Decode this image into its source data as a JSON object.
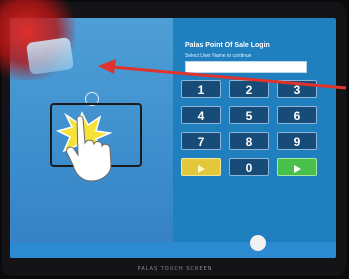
{
  "app": {
    "title": "Palas Point Of Sale Login",
    "subtitle": "Select User Name to continue",
    "username_value": ""
  },
  "keypad": {
    "keys": [
      "1",
      "2",
      "3",
      "4",
      "5",
      "6",
      "7",
      "8",
      "9"
    ],
    "zero": "0"
  },
  "bezel": {
    "brand": "PALAS  TOUCH  SCREEN"
  },
  "colors": {
    "left_pane": "#4f9ed6",
    "right_pane": "#1f7fbf",
    "key": "#184c78",
    "back_key": "#e2c83a",
    "enter_key": "#49c04b",
    "annotation_arrow": "#e0332e"
  },
  "icons": {
    "back": "arrow-left-icon",
    "enter": "arrow-right-icon",
    "touch": "pointing-hand-icon"
  }
}
